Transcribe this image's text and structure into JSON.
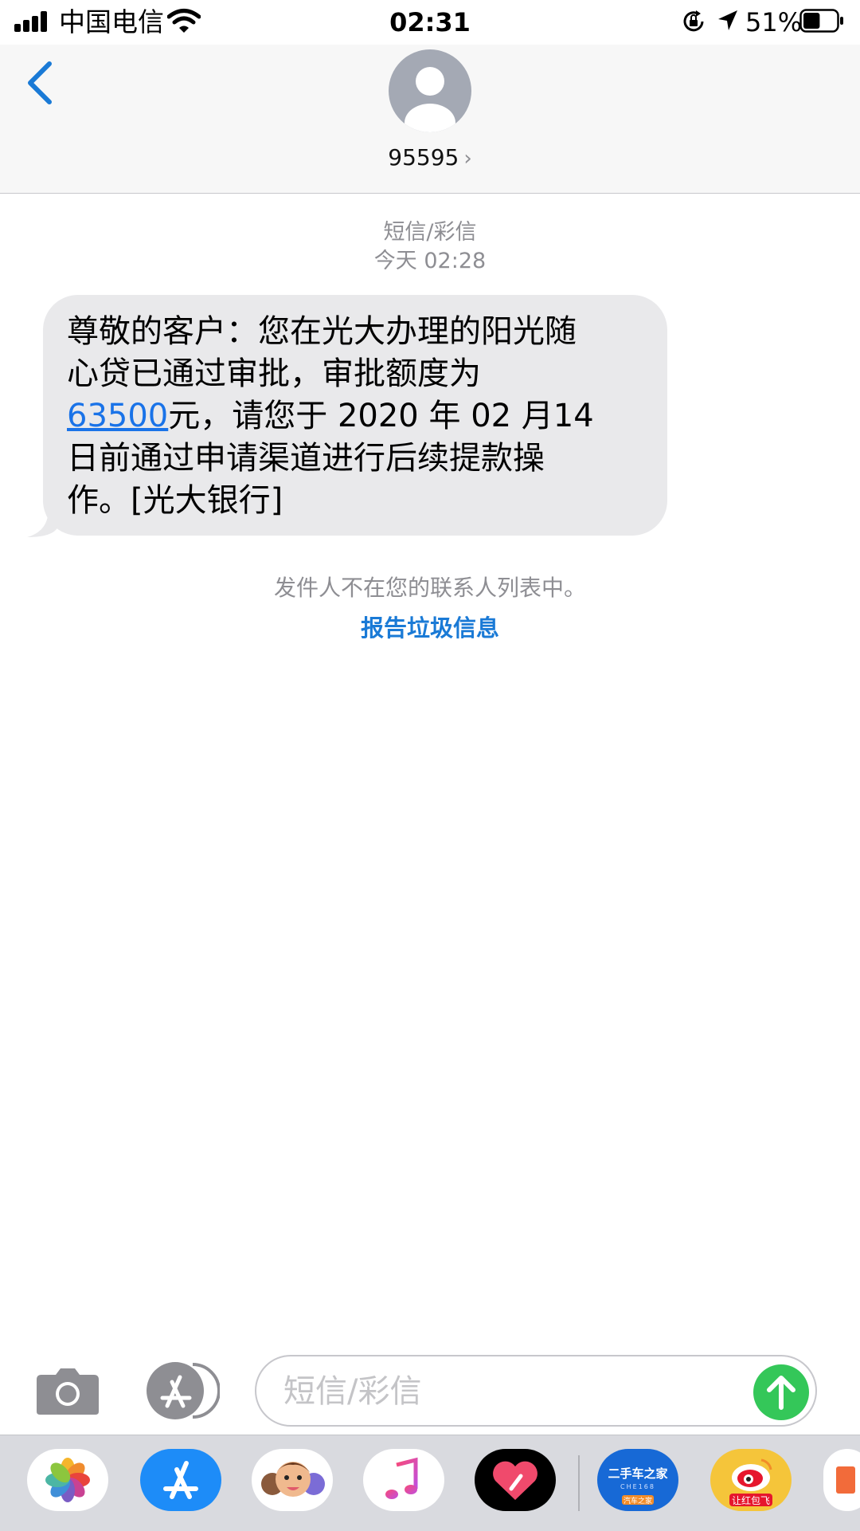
{
  "status_bar": {
    "carrier": "中国电信",
    "time": "02:31",
    "battery_percent": "51%",
    "battery_level": 0.51,
    "icons": [
      "signal-icon",
      "wifi-icon",
      "rotation-lock-icon",
      "location-icon",
      "battery-icon"
    ]
  },
  "header": {
    "contact": "95595",
    "chevron": "›",
    "icons": [
      "back-chevron-icon",
      "contact-avatar-icon"
    ]
  },
  "thread": {
    "message_type": "短信/彩信",
    "timestamp": "今天 02:28",
    "message": {
      "line1": "尊敬的客户：您在光大办理的阳光随",
      "line2": "心贷已通过审批，审批额度为",
      "amount": "63500",
      "line3_rest": "元，请您于 2020 年 02 月14",
      "line4": "日前通过申请渠道进行后续提款操",
      "line5": "作。[光大银行]"
    },
    "notice": "发件人不在您的联系人列表中。",
    "report_link": "报告垃圾信息"
  },
  "composer": {
    "placeholder": "短信/彩信",
    "icons": [
      "camera-icon",
      "app-store-icon",
      "send-arrow-icon"
    ]
  },
  "app_drawer": {
    "apps": [
      {
        "name": "photos-app-icon",
        "color": "#ffffff"
      },
      {
        "name": "app-store-app-icon",
        "color": "#1d8cf8"
      },
      {
        "name": "memoji-app-icon",
        "color": "#ffffff"
      },
      {
        "name": "music-app-icon",
        "color": "#ffffff"
      },
      {
        "name": "digital-touch-app-icon",
        "color": "#000000"
      },
      {
        "name": "che168-app-icon",
        "color": "#1769d6",
        "text": "二手车之家",
        "subtext": "CHE168",
        "badge": "汽车之家"
      },
      {
        "name": "weibo-app-icon",
        "color": "#f5c53a",
        "text": "让红包飞"
      },
      {
        "name": "partial-app-icon",
        "color": "#ffffff"
      }
    ]
  },
  "colors": {
    "bubble": "#e9e9eb",
    "link_blue": "#1a7ad6",
    "send_green": "#34c759",
    "gray_text": "#8e8e93"
  }
}
